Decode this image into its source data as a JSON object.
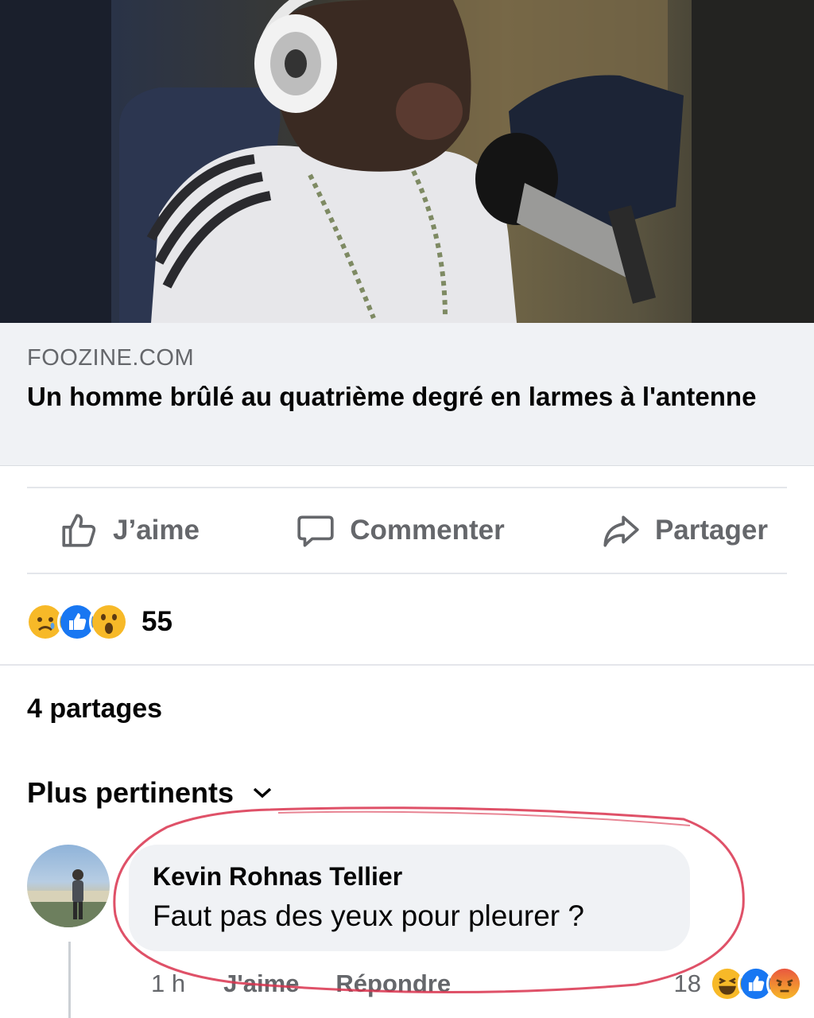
{
  "post": {
    "link": {
      "domain": "FOOZINE.COM",
      "title": "Un homme brûlé au quatrième degré en larmes à l'antenne"
    },
    "actions": {
      "like_label": "J’aime",
      "comment_label": "Commenter",
      "share_label": "Partager"
    },
    "reactions": {
      "icons": [
        "sad-emoji-icon",
        "like-icon",
        "wow-emoji-icon"
      ],
      "count": "55"
    },
    "shares": "4 partages",
    "sort_label": "Plus pertinents"
  },
  "comment": {
    "author": "Kevin Rohnas Tellier",
    "text": "Faut pas des yeux pour pleurer ?",
    "time": "1 h",
    "like_label": "J'aime",
    "reply_label": "Répondre",
    "reaction_count": "18",
    "reaction_icons": [
      "haha-emoji-icon",
      "like-icon",
      "angry-emoji-icon"
    ]
  },
  "colors": {
    "secondary_text": "#65676b",
    "link_bg": "#f0f2f5",
    "like_blue": "#1877f2",
    "annotation_red": "#d9334d"
  }
}
